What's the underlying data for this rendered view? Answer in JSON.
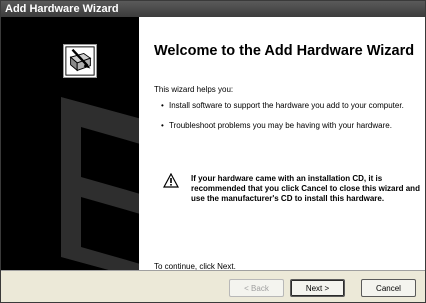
{
  "window": {
    "title": "Add Hardware Wizard"
  },
  "sidebar": {
    "icon": "hardware-wizard-icon",
    "watermark": "wizard-watermark-graphic"
  },
  "content": {
    "heading": "Welcome to the Add Hardware Wizard",
    "intro": "This wizard helps you:",
    "bullets": [
      "Install software to support the hardware you add to your computer.",
      "Troubleshoot problems you may be having with your hardware."
    ],
    "warning_icon": "warning-icon",
    "warning": "If your hardware came with an installation CD, it is recommended that you click Cancel to close this wizard and use the manufacturer's CD to install this hardware.",
    "continue": "To continue, click Next."
  },
  "buttons": {
    "back": "< Back",
    "next": "Next >",
    "cancel": "Cancel"
  }
}
